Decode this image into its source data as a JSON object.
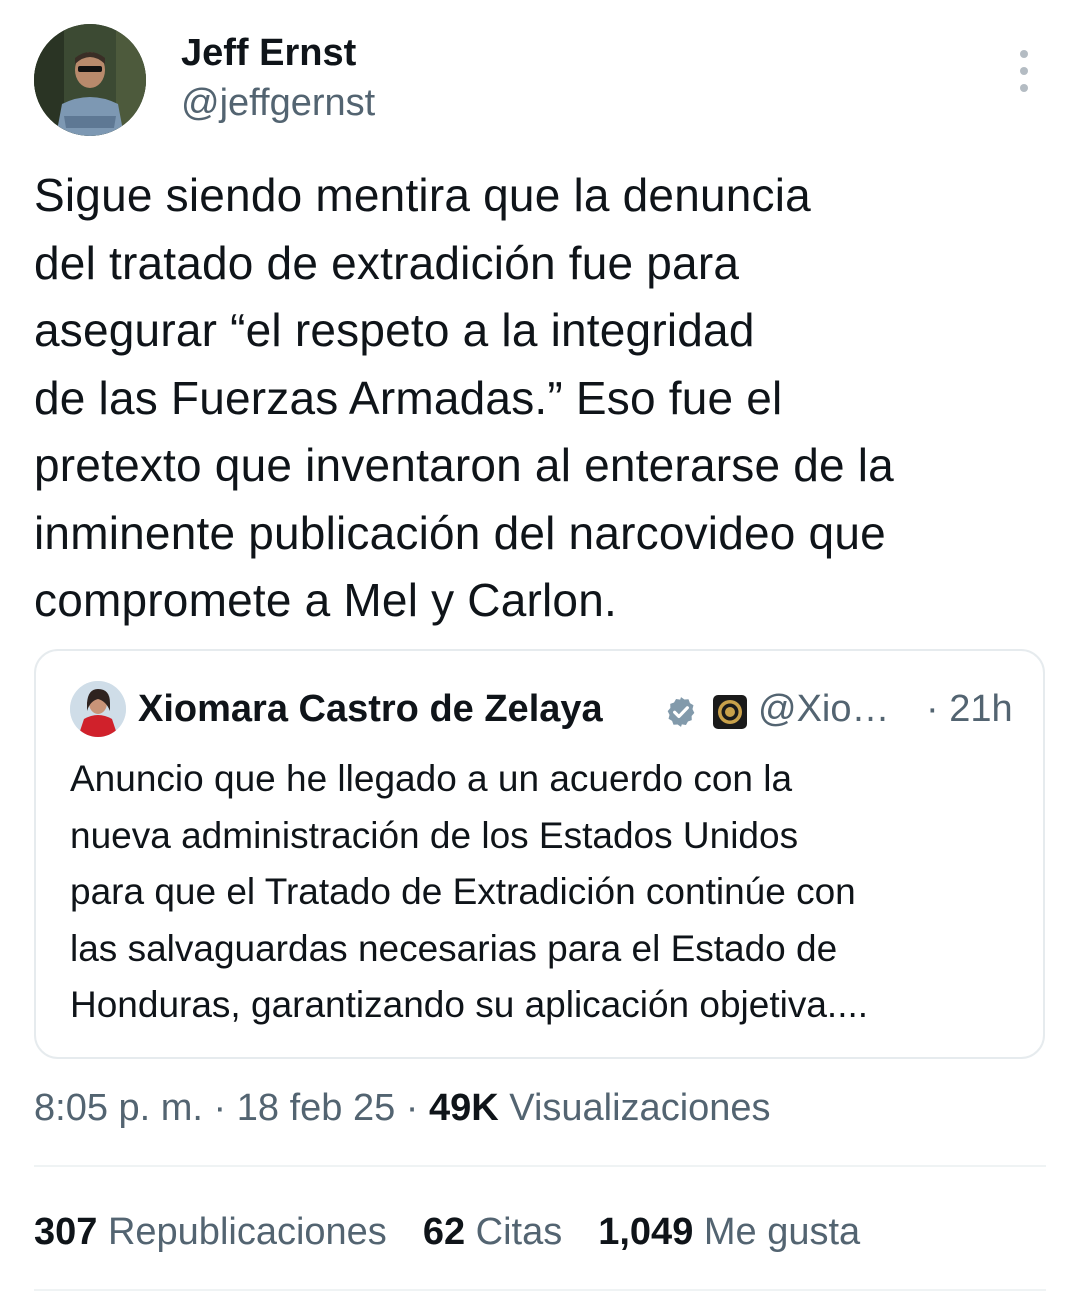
{
  "author": {
    "name": "Jeff Ernst",
    "handle": "@jeffgernst"
  },
  "tweet": {
    "text": "Sigue siendo mentira que la denuncia\ndel tratado de extradición fue para\nasegurar “el respeto a la integridad\nde las Fuerzas Armadas.” Eso fue el\npretexto que inventaron al enterarse de la\ninminente publicación del narcovideo que\ncompromete a Mel y Carlon."
  },
  "quoted": {
    "name": "Xiomara Castro de Zelaya",
    "handle": "@Xio…",
    "time": "· 21h",
    "text": "Anuncio que he llegado a un acuerdo con la\nnueva administración de los Estados Unidos\npara que el Tratado de Extradición continúe con\nlas salvaguardas necesarias para el Estado de\nHonduras, garantizando su aplicación objetiva...."
  },
  "meta": {
    "time": "8:05 p. m.",
    "sep1": " · ",
    "date": "18 feb 25",
    "sep2": " · ",
    "views_count": "49K",
    "views_label": " Visualizaciones"
  },
  "stats": {
    "reposts_count": "307",
    "reposts_label": " Republicaciones",
    "quotes_count": "62",
    "quotes_label": " Citas",
    "likes_count": "1,049",
    "likes_label": " Me gusta"
  },
  "colors": {
    "text": "#0f1419",
    "secondary": "#536471",
    "border": "#e6ebee",
    "verified": "#829aab"
  },
  "icons": [
    "more-icon",
    "verified-badge-icon",
    "affiliate-seal-icon"
  ]
}
